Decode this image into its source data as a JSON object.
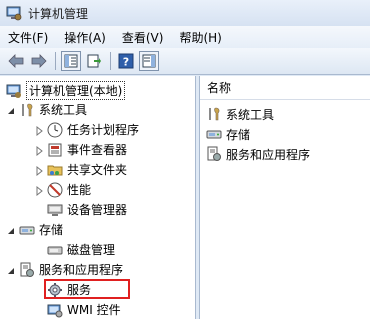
{
  "window": {
    "title": "计算机管理"
  },
  "menu": [
    "文件(F)",
    "操作(A)",
    "查看(V)",
    "帮助(H)"
  ],
  "toolbar": {
    "buttons": [
      "back-arrow-icon",
      "forward-arrow-icon",
      "show-hide-tree-icon",
      "export-list-icon",
      "help-icon",
      "action-pane-icon"
    ]
  },
  "tree": {
    "root": "计算机管理(本地)",
    "system_tools": "系统工具",
    "task_scheduler": "任务计划程序",
    "event_viewer": "事件查看器",
    "shared_folders": "共享文件夹",
    "performance": "性能",
    "device_manager": "设备管理器",
    "storage": "存储",
    "disk_management": "磁盘管理",
    "services_apps": "服务和应用程序",
    "services": "服务",
    "wmi": "WMI 控件"
  },
  "list": {
    "column_header": "名称",
    "items": [
      "系统工具",
      "存储",
      "服务和应用程序"
    ]
  },
  "colors": {
    "highlight": "#e02020",
    "accent": "#3c6fb4"
  }
}
